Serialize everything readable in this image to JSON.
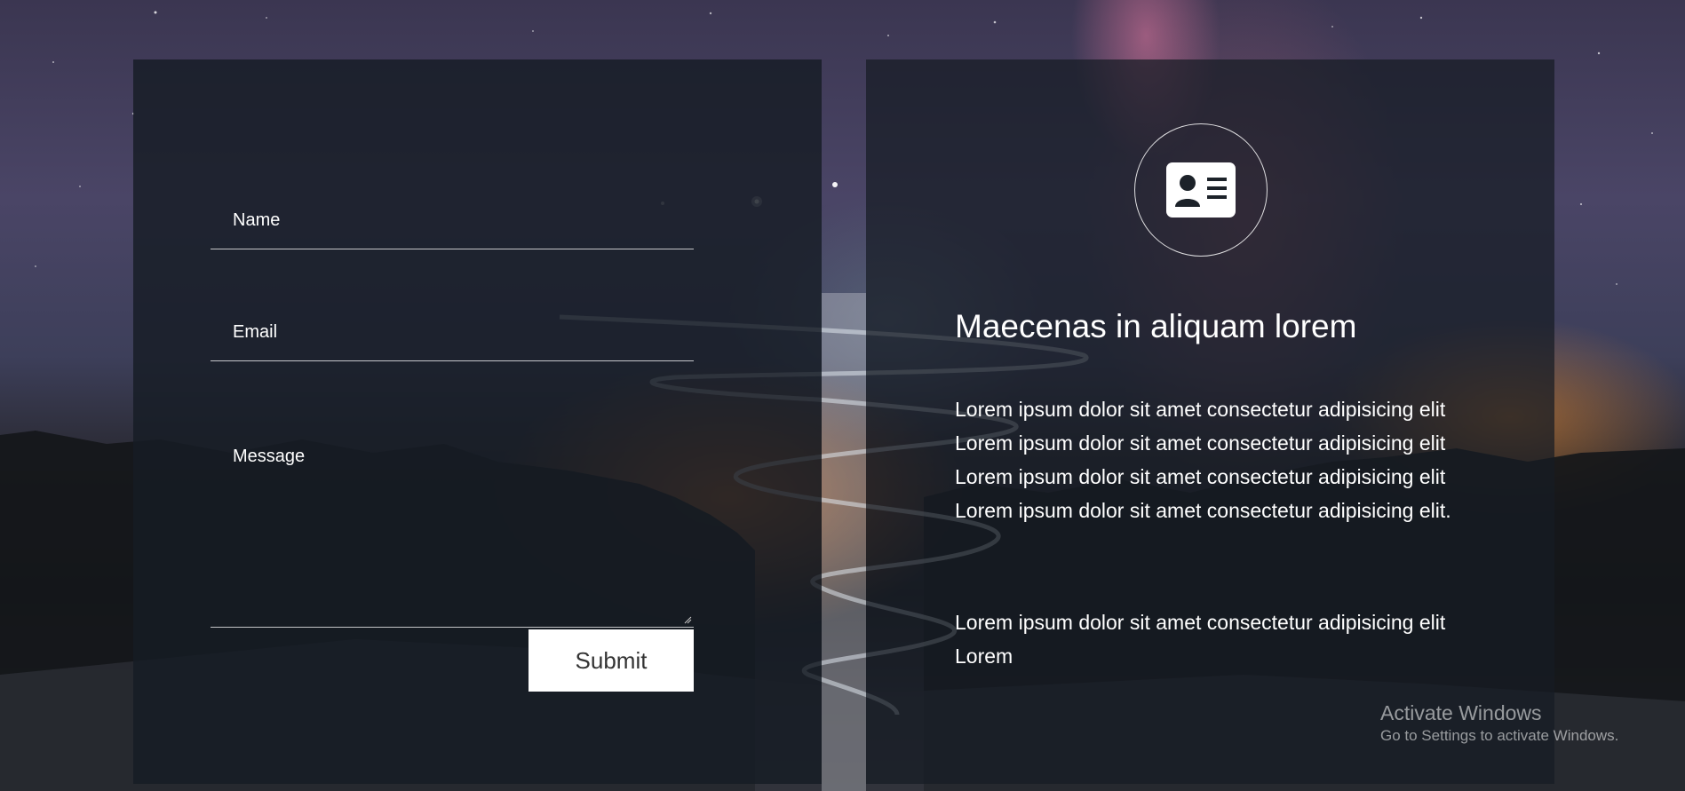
{
  "form": {
    "name_label": "Name",
    "email_label": "Email",
    "message_label": "Message",
    "submit_label": "Submit"
  },
  "info": {
    "icon": "contact-card-icon",
    "title": "Maecenas in aliquam lorem",
    "paragraph_1": "Lorem ipsum dolor sit amet consectetur adipisicing elit Lorem ipsum dolor sit amet consectetur adipisicing elit Lorem ipsum dolor sit amet consectetur adipisicing elit Lorem ipsum dolor sit amet consectetur adipisicing elit.",
    "paragraph_2": "Lorem ipsum dolor sit amet consectetur adipisicing elit Lorem"
  },
  "watermark": {
    "title": "Activate Windows",
    "subtitle": "Go to Settings to activate Windows."
  },
  "colors": {
    "panel_bg": "#161c24",
    "text": "#ffffff",
    "button_bg": "#ffffff",
    "button_text": "#333333"
  }
}
